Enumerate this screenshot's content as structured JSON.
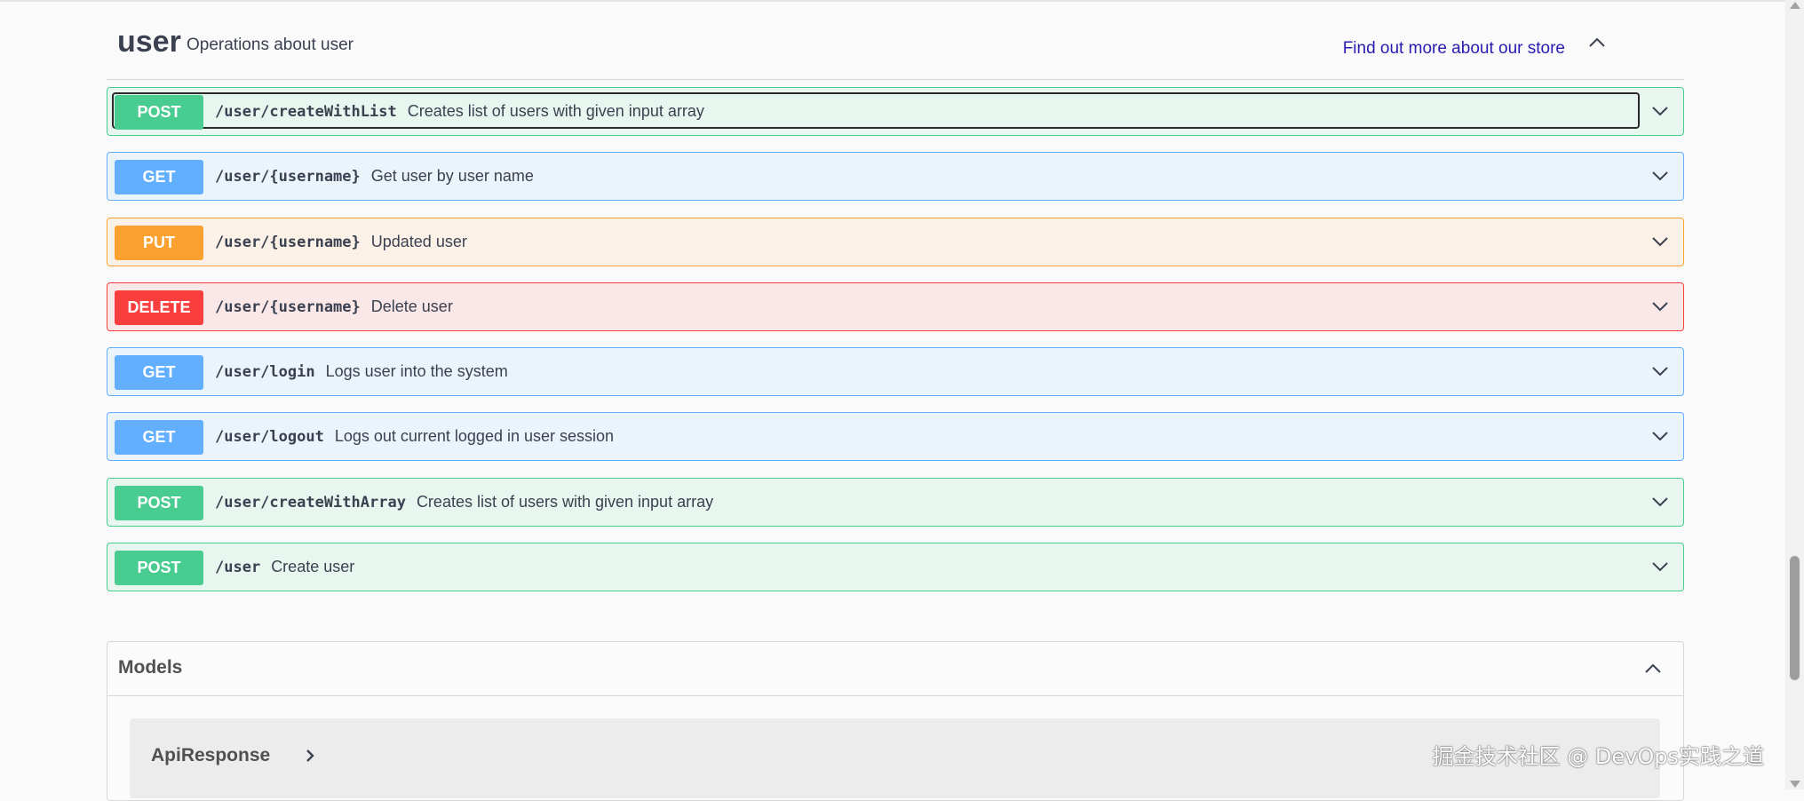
{
  "tag": {
    "name": "user",
    "description": "Operations about user",
    "link_text": "Find out more about our store"
  },
  "operations": [
    {
      "method": "POST",
      "path": "/user/createWithList",
      "summary": "Creates list of users with given input array"
    },
    {
      "method": "GET",
      "path": "/user/{username}",
      "summary": "Get user by user name"
    },
    {
      "method": "PUT",
      "path": "/user/{username}",
      "summary": "Updated user"
    },
    {
      "method": "DELETE",
      "path": "/user/{username}",
      "summary": "Delete user"
    },
    {
      "method": "GET",
      "path": "/user/login",
      "summary": "Logs user into the system"
    },
    {
      "method": "GET",
      "path": "/user/logout",
      "summary": "Logs out current logged in user session"
    },
    {
      "method": "POST",
      "path": "/user/createWithArray",
      "summary": "Creates list of users with given input array"
    },
    {
      "method": "POST",
      "path": "/user",
      "summary": "Create user"
    }
  ],
  "models": {
    "title": "Models",
    "items": [
      {
        "name": "ApiResponse"
      }
    ]
  },
  "watermark": "掘金技术社区 @ DevOps实践之道",
  "colors": {
    "post": "#49cc90",
    "get": "#61affe",
    "put": "#fca130",
    "delete": "#f93e3e",
    "link": "#2a1cb0"
  }
}
